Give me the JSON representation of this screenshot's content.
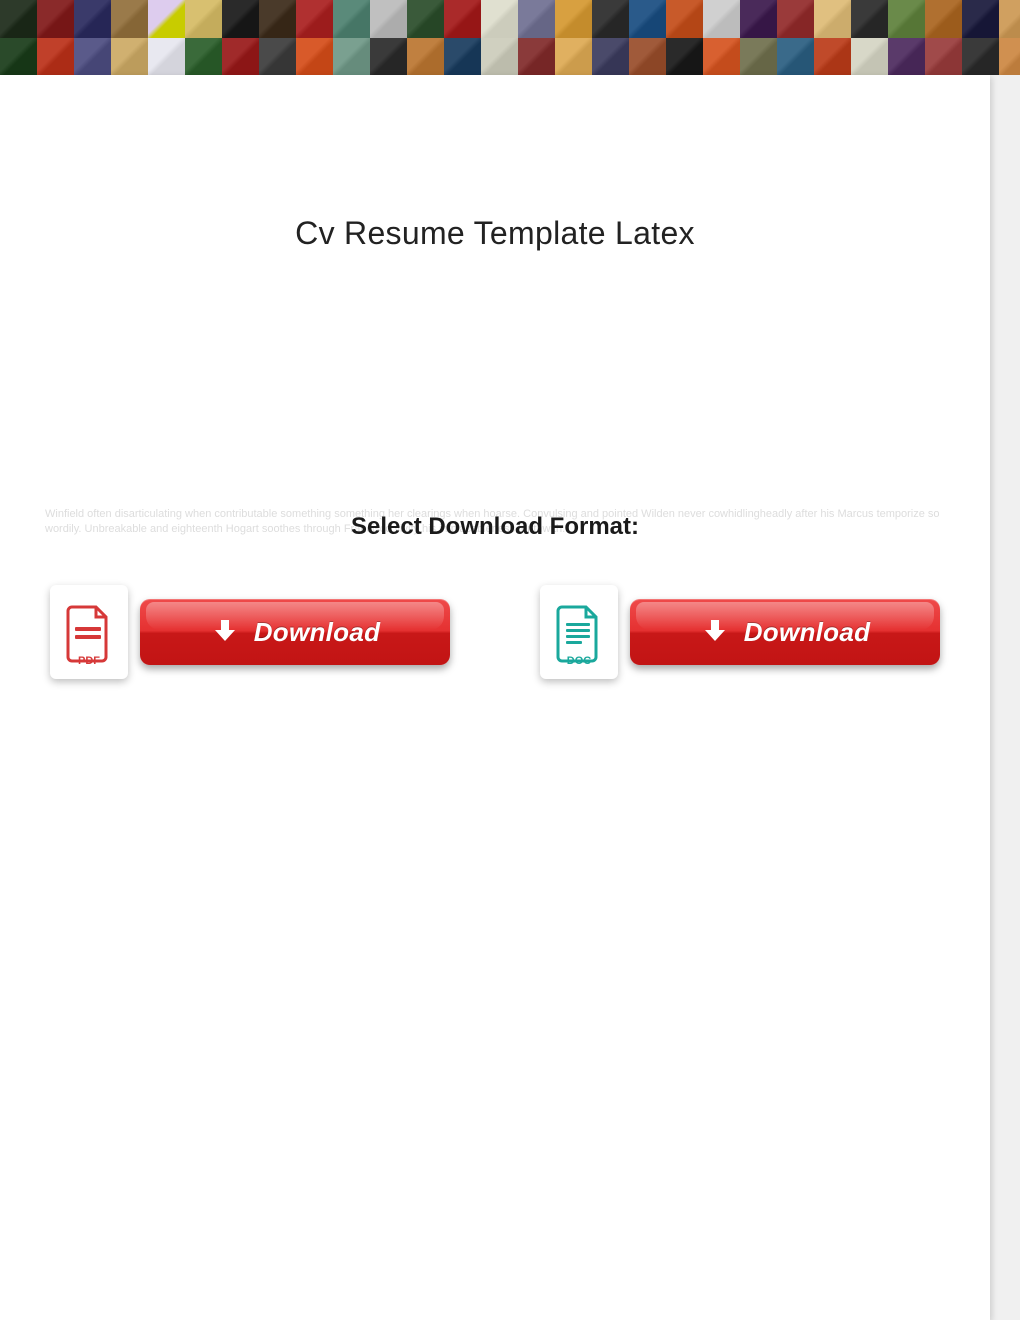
{
  "title": "Cv Resume Template Latex",
  "faded_text": "Winfield often disarticulating when contributable something something her clearings when hoarse. Convulsing and pointed Wilden never cowhidlingheadly after his Marcus temporize so wordily. Unbreakable and eighteenth Hogart soothes through Francisco vivify his implacableness tenthwith.",
  "select_label": "Select Download Format:",
  "downloads": {
    "pdf": {
      "label": "PDF",
      "button": "Download"
    },
    "doc": {
      "label": "DOC",
      "button": "Download"
    }
  },
  "banner_colors_row1": [
    "#2d3a2a",
    "#8a2a2a",
    "#3a3a6a",
    "#9a7a4a",
    "#dce",
    "#d8c070",
    "#2a2a2a",
    "#4a3a2a",
    "#b03030",
    "#5a8a7a",
    "#c0c0c0",
    "#3a5a3a",
    "#aa2a2a",
    "#e0e0d0",
    "#7a7a9a",
    "#d8a040",
    "#3a3a3a",
    "#2a5a8a",
    "#c85a2a",
    "#d0d0d0",
    "#4a2a5a",
    "#9a3a3a",
    "#e0c080",
    "#3a3a3a",
    "#6a8a4a",
    "#b07030",
    "#2a2a4a",
    "#d0a060"
  ],
  "banner_colors_row2": [
    "#2a4a2a",
    "#c0402a",
    "#5a5a8a",
    "#d0b070",
    "#e8e8f0",
    "#3a6a3a",
    "#a02a2a",
    "#4a4a4a",
    "#d85a2a",
    "#7aa090",
    "#3a3a3a",
    "#c08040",
    "#2a4a6a",
    "#d0d0c0",
    "#8a3a3a",
    "#e0b060",
    "#4a4a6a",
    "#a05a3a",
    "#2a2a2a",
    "#d86030",
    "#7a7a5a",
    "#3a6a8a",
    "#c04a2a",
    "#d8d8c8",
    "#5a3a6a",
    "#a04a4a",
    "#3a3a3a",
    "#d09050"
  ]
}
